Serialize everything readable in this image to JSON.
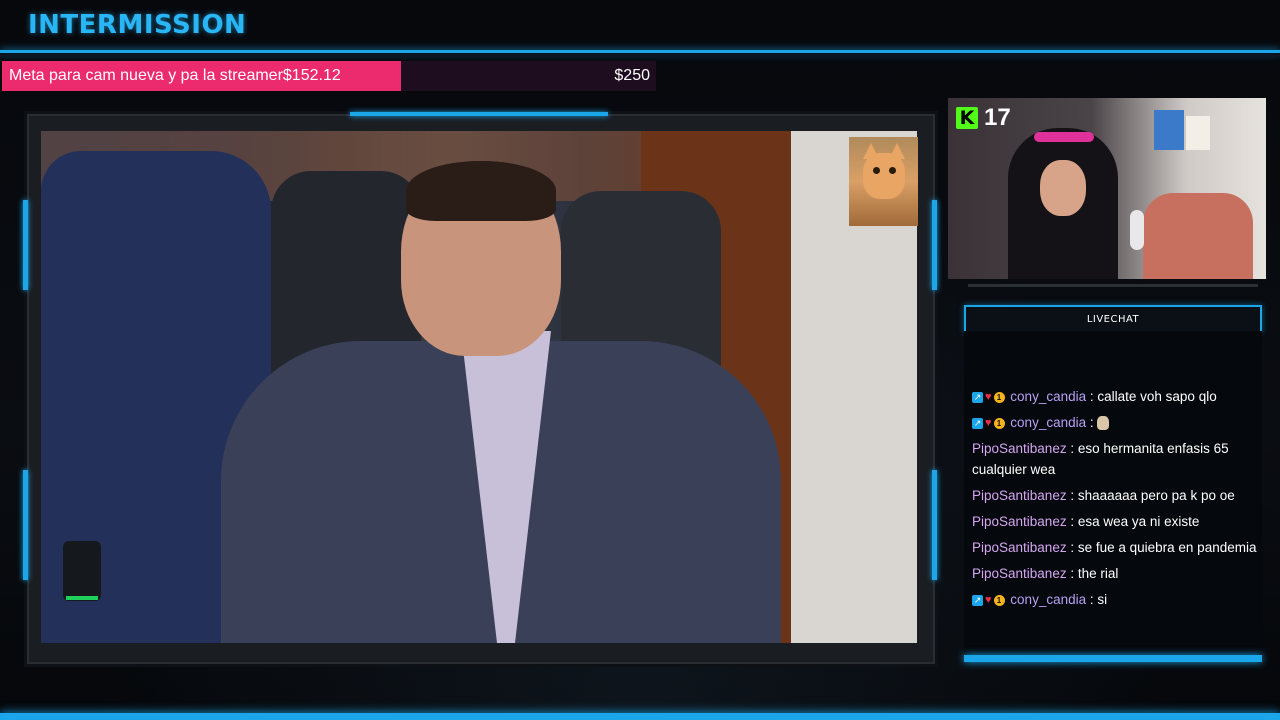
{
  "header": {
    "title": "INTERMISSION"
  },
  "goal": {
    "label": "Meta para cam nueva y pa la streamer$152.12",
    "current": 152.12,
    "target_label": "$250",
    "progress_fraction": 0.61,
    "fill_color": "#ec2a6e"
  },
  "webcam": {
    "viewer_count": "17",
    "platform_icon": "kick-logo",
    "platform_letter": "K"
  },
  "chat": {
    "header": "LIVECHAT",
    "messages": [
      {
        "user": "cony_candia",
        "text": ": callate voh sapo qlo",
        "badges": true
      },
      {
        "user": "cony_candia",
        "text": ":",
        "badges": true,
        "emote": true
      },
      {
        "user": "PipoSantibanez",
        "text": ": eso hermanita enfasis 65 cualquier wea",
        "badges": false
      },
      {
        "user": "PipoSantibanez",
        "text": ": shaaaaaa pero pa k po oe",
        "badges": false
      },
      {
        "user": "PipoSantibanez",
        "text": ": esa wea ya ni existe",
        "badges": false
      },
      {
        "user": "PipoSantibanez",
        "text": ": se fue a quiebra en pandemia",
        "badges": false
      },
      {
        "user": "PipoSantibanez",
        "text": ": the rial",
        "badges": false
      },
      {
        "user": "cony_candia",
        "text": ": si",
        "badges": true
      }
    ]
  },
  "colors": {
    "accent": "#1aa6e8",
    "goal_fill": "#ec2a6e",
    "kick_green": "#53fc18"
  }
}
